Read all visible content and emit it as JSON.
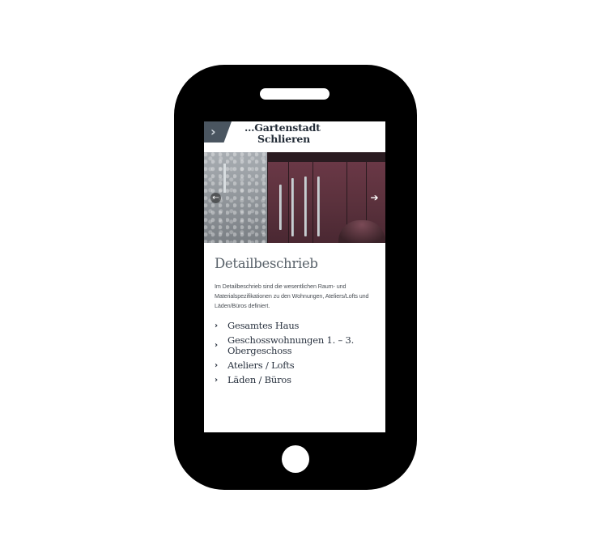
{
  "header": {
    "logo_line1": "…Gartenstadt",
    "logo_line2": "Schlieren",
    "menu_icon": "chevron-right-icon"
  },
  "hero": {
    "prev_icon": "arrow-left-icon",
    "next_icon": "arrow-right-icon",
    "prev_glyph": "←",
    "next_glyph": "➔"
  },
  "main": {
    "title": "Detailbeschrieb",
    "intro": "Im Detailbeschrieb sind die wesentlichen Raum- und Materialspezifikationen zu den Wohnungen, Ateliers/Lofts und Läden/Büros definiert.",
    "links": [
      {
        "label": "Gesamtes Haus"
      },
      {
        "label": "Geschosswohnungen 1. – 3. Obergeschoss"
      },
      {
        "label": "Ateliers / Lofts"
      },
      {
        "label": "Läden / Büros"
      }
    ]
  },
  "colors": {
    "phone_frame": "#000000",
    "header_tab": "#4a5560",
    "title_text": "#5a636b",
    "link_text": "#2a3340"
  }
}
